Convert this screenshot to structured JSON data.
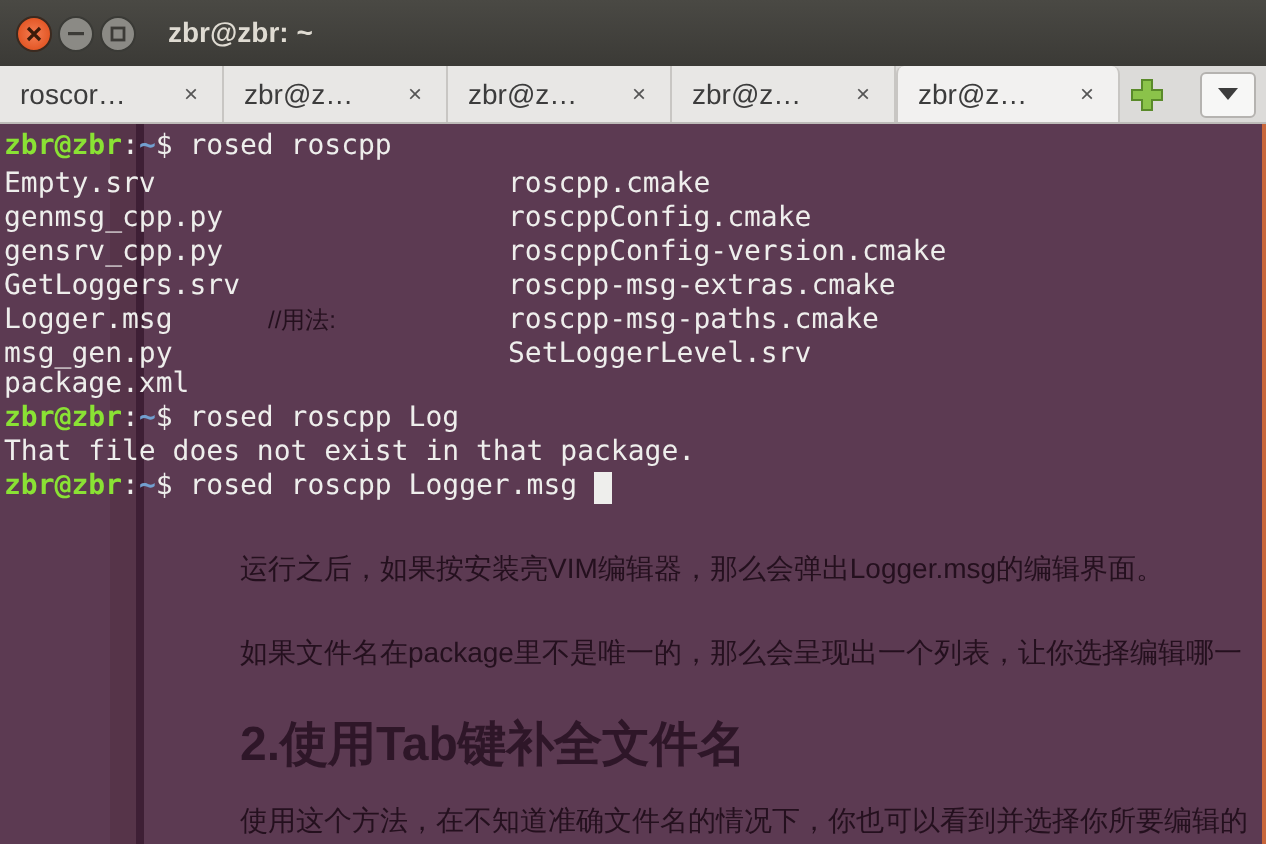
{
  "window": {
    "title": "zbr@zbr: ~"
  },
  "tabs": [
    {
      "label": "roscor…",
      "selected": false,
      "close": "×"
    },
    {
      "label": "zbr@z…",
      "selected": false,
      "close": "×"
    },
    {
      "label": "zbr@z…",
      "selected": false,
      "close": "×"
    },
    {
      "label": "zbr@z…",
      "selected": false,
      "close": "×"
    },
    {
      "label": "zbr@z…",
      "selected": true,
      "close": "×"
    }
  ],
  "background_page": {
    "note": "//用法:",
    "paragraphs": [
      {
        "kind": "text",
        "text": "运行之后，如果按安装亮VIM编辑器，那么会弹出Logger.msg的编辑界面。"
      },
      {
        "kind": "text",
        "text": "如果文件名在package里不是唯一的，那么会呈现出一个列表，让你选择编辑哪一"
      },
      {
        "kind": "heading",
        "text": "2.使用Tab键补全文件名"
      },
      {
        "kind": "text",
        "text": "使用这个方法，在不知道准确文件名的情况下，你也可以看到并选择你所要编辑的"
      }
    ]
  },
  "terminal": [
    {
      "kind": "prompt",
      "user": "zbr@zbr",
      "sep": ":",
      "path": "~",
      "symbol": "$",
      "command": "rosed roscpp",
      "cursor": false
    },
    {
      "kind": "listing",
      "left": "Empty.srv",
      "right": "roscpp.cmake"
    },
    {
      "kind": "listing",
      "left": "genmsg_cpp.py",
      "right": "roscppConfig.cmake"
    },
    {
      "kind": "listing",
      "left": "gensrv_cpp.py",
      "right": "roscppConfig-version.cmake"
    },
    {
      "kind": "listing",
      "left": "GetLoggers.srv",
      "right": "roscpp-msg-extras.cmake"
    },
    {
      "kind": "listing",
      "left": "Logger.msg",
      "right": "roscpp-msg-paths.cmake"
    },
    {
      "kind": "listing",
      "left": "msg_gen.py",
      "right": "SetLoggerLevel.srv"
    },
    {
      "kind": "output",
      "text": "package.xml"
    },
    {
      "kind": "prompt",
      "user": "zbr@zbr",
      "sep": ":",
      "path": "~",
      "symbol": "$",
      "command": "rosed roscpp Log",
      "cursor": false
    },
    {
      "kind": "output",
      "text": "That file does not exist in that package."
    },
    {
      "kind": "prompt",
      "user": "zbr@zbr",
      "sep": ":",
      "path": "~",
      "symbol": "$",
      "command": "rosed roscpp Logger.msg",
      "cursor": true
    }
  ]
}
